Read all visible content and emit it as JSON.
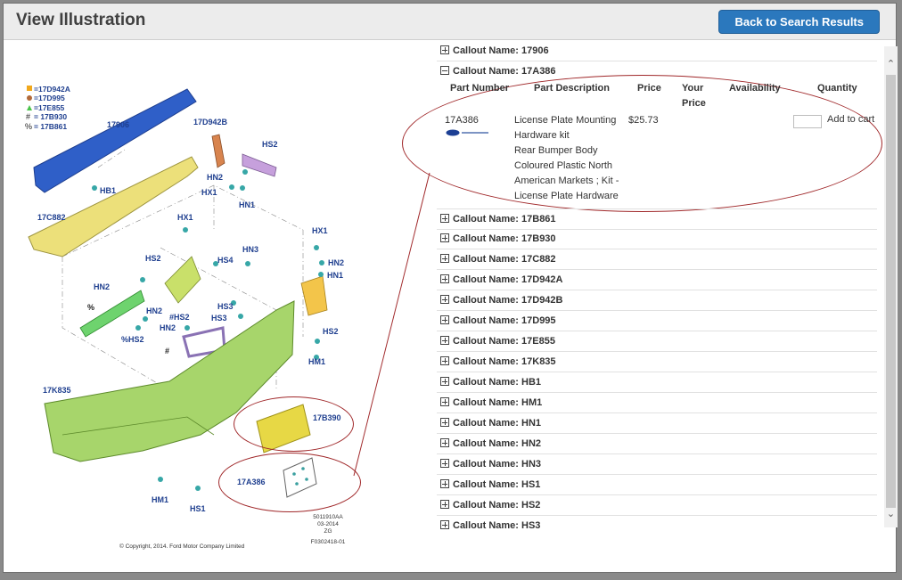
{
  "header": {
    "title": "View Illustration",
    "back_button": "Back to Search Results"
  },
  "illustration": {
    "legend": [
      "=17D942A",
      "=17D995",
      "=17E855",
      "= 17B930",
      "= 17B861"
    ],
    "legend_symbols": [
      "#",
      "%"
    ],
    "callouts": [
      "17906",
      "17D942B",
      "HS2",
      "HN2",
      "HX1",
      "HN1",
      "HB1",
      "17C882",
      "HX1",
      "HX1",
      "HN2",
      "HN1",
      "HN3",
      "HS2",
      "HS4",
      "HN2",
      "HN2",
      "HN2",
      "#HS2",
      "HS3",
      "HS3",
      "%HS2",
      "#",
      "%",
      "HS2",
      "HM1",
      "17K835",
      "17B390",
      "17A386",
      "HM1",
      "HS1"
    ],
    "footer_code": [
      "5011910AA",
      "03-2014",
      "ZG",
      "F0302418-01"
    ],
    "copyright": "© Copyright, 2014. Ford Motor Company Limited"
  },
  "callouts_panel": {
    "items": [
      {
        "label": "Callout Name: 17906",
        "expanded": false
      },
      {
        "label": "Callout Name: 17A386",
        "expanded": true
      },
      {
        "label": "Callout Name: 17B861",
        "expanded": false
      },
      {
        "label": "Callout Name: 17B930",
        "expanded": false
      },
      {
        "label": "Callout Name: 17C882",
        "expanded": false
      },
      {
        "label": "Callout Name: 17D942A",
        "expanded": false
      },
      {
        "label": "Callout Name: 17D942B",
        "expanded": false
      },
      {
        "label": "Callout Name: 17D995",
        "expanded": false
      },
      {
        "label": "Callout Name: 17E855",
        "expanded": false
      },
      {
        "label": "Callout Name: 17K835",
        "expanded": false
      },
      {
        "label": "Callout Name: HB1",
        "expanded": false
      },
      {
        "label": "Callout Name: HM1",
        "expanded": false
      },
      {
        "label": "Callout Name: HN1",
        "expanded": false
      },
      {
        "label": "Callout Name: HN2",
        "expanded": false
      },
      {
        "label": "Callout Name: HN3",
        "expanded": false
      },
      {
        "label": "Callout Name: HS1",
        "expanded": false
      },
      {
        "label": "Callout Name: HS2",
        "expanded": false
      },
      {
        "label": "Callout Name: HS3",
        "expanded": false
      }
    ],
    "table": {
      "headers": {
        "part_number": "Part Number",
        "description": "Part Description",
        "price": "Price",
        "your_price_1": "Your",
        "your_price_2": "Price",
        "availability": "Availability",
        "quantity": "Quantity"
      },
      "row": {
        "part_number": "17A386",
        "description_lines": [
          "License Plate Mounting",
          "Hardware kit",
          "Rear Bumper Body",
          "Coloured Plastic North",
          "American Markets ; Kit -",
          "License Plate Hardware"
        ],
        "price": "$25.73",
        "quantity_value": "",
        "add_to_cart": "Add to cart"
      }
    }
  },
  "colors": {
    "accent": "#2b78bd",
    "highlight_oval": "#a0282a",
    "label_blue": "#1f3f8f"
  }
}
